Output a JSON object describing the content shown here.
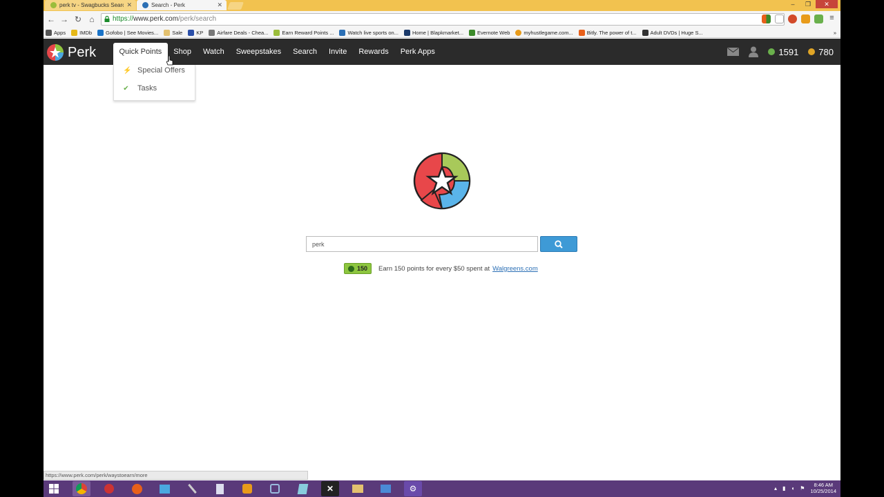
{
  "browser": {
    "tabs": [
      {
        "title": "perk tv - Swagbucks Searc",
        "active": false,
        "favicon_color": "#9bbd3b"
      },
      {
        "title": "Search - Perk",
        "active": true,
        "favicon_color": "#2b6fb5"
      }
    ],
    "url_scheme": "https://",
    "url_host": "www.perk.com",
    "url_path": "/perk/search",
    "bookmarks": [
      {
        "label": "Apps",
        "icon": "apps-grid-icon",
        "color": "#555"
      },
      {
        "label": "IMDb",
        "icon": "imdb-icon",
        "color": "#e5b818"
      },
      {
        "label": "Gofobo | See Movies...",
        "icon": "gofobo-icon",
        "color": "#1a73c7"
      },
      {
        "label": "Sale",
        "icon": "folder-icon",
        "color": "#e3c16f"
      },
      {
        "label": "KP",
        "icon": "kp-icon",
        "color": "#2b4fa8"
      },
      {
        "label": "Airfare Deals - Chea...",
        "icon": "airfare-icon",
        "color": "#555"
      },
      {
        "label": "Earn Reward Points ...",
        "icon": "reward-icon",
        "color": "#9bbd3b"
      },
      {
        "label": "Watch live sports on...",
        "icon": "sports-icon",
        "color": "#2b6fb5"
      },
      {
        "label": "Home | Blapkmarket...",
        "icon": "blapk-icon",
        "color": "#1b3a6a"
      },
      {
        "label": "Evernote Web",
        "icon": "evernote-icon",
        "color": "#3b8a2a"
      },
      {
        "label": "myhustlegame.com...",
        "icon": "hustle-icon",
        "color": "#e89b1a"
      },
      {
        "label": "Bitly. The power of t...",
        "icon": "bitly-icon",
        "color": "#e8601a"
      },
      {
        "label": "Adult DVDs | Huge S...",
        "icon": "adt-icon",
        "color": "#333"
      }
    ],
    "status_url": "https://www.perk.com/perk/waystoearn/more"
  },
  "perk_nav": {
    "logo_text": "Perk",
    "items": [
      "Quick Points",
      "Shop",
      "Watch",
      "Sweepstakes",
      "Search",
      "Invite",
      "Rewards",
      "Perk Apps"
    ],
    "active_item": "Quick Points",
    "points_green": "1591",
    "points_gold": "780"
  },
  "dropdown": {
    "items": [
      {
        "label": "Special Offers",
        "icon": "lightning-icon"
      },
      {
        "label": "Tasks",
        "icon": "checkmark-icon"
      }
    ]
  },
  "search": {
    "value": "perk",
    "button_icon": "search-icon"
  },
  "promo": {
    "badge_points": "150",
    "text": "Earn 150 points for every $50 spent at",
    "link": "Walgreens.com"
  },
  "taskbar": {
    "time": "8:46 AM",
    "date": "10/25/2014"
  },
  "colors": {
    "nav_bg": "#2b2b2b",
    "search_button": "#3e9ad6",
    "points_green": "#6ab04c",
    "points_gold": "#e0a526",
    "taskbar": "#5a3a7a"
  }
}
